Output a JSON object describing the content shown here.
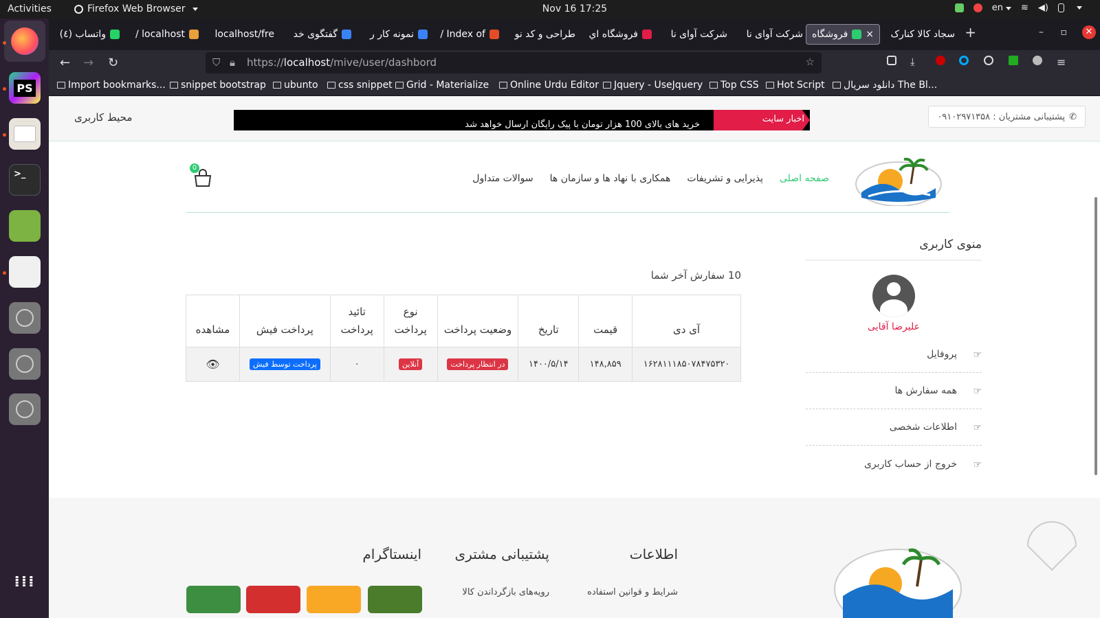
{
  "os": {
    "activities": "Activities",
    "app_name": "Firefox Web Browser",
    "clock": "Nov 16  17:25",
    "lang": "en"
  },
  "tabs": [
    {
      "label": "واتساب (٤)",
      "color": "#25d366"
    },
    {
      "label": "localhost /",
      "color": "#e8a03a"
    },
    {
      "label": "localhost/fre",
      "color": ""
    },
    {
      "label": "گفتگوی خد",
      "color": "#3b82f6"
    },
    {
      "label": "نمونه کار ر",
      "color": "#3b82f6"
    },
    {
      "label": "Index of /",
      "color": "#e34c26"
    },
    {
      "label": "طراحی و کد نو",
      "color": ""
    },
    {
      "label": "فروشگاه اي",
      "color": "#e11d48"
    },
    {
      "label": "شرکت آوای نا",
      "color": ""
    },
    {
      "label": "شرکت آوای نا",
      "color": ""
    },
    {
      "label": "فروشگاه",
      "color": "#2ecc71"
    },
    {
      "label": "سجاد کالا کنارک",
      "color": ""
    }
  ],
  "tab_close": "×",
  "new_tab": "+",
  "url": {
    "prefix": "https://",
    "host": "localhost",
    "path": "/mive/user/dashbord"
  },
  "bookmarks": [
    "Import bookmarks...",
    "snippet bootstrap",
    "ubunto",
    "css snippet",
    "Grid - Materialize",
    "Online Urdu Editor",
    "Jquery - UseJquery",
    "Top CSS",
    "Hot Script",
    "دانلود سریال The Bl..."
  ],
  "site": {
    "support": "پشتیبانی مشتریان : ۰۹۱۰۲۹۷۱۳۵۸",
    "ticker_label": "اخبار سایت",
    "ticker_line1": "خرید های بالای 100 هزار تومان با پیک رایگان ارسال خواهد شد",
    "user_zone": "محیط کاربری",
    "menu": [
      "صفحه اصلی",
      "پذیرایی و تشریفات",
      "همکاری با نهاد ها و سازمان ها",
      "سوالات متداول"
    ],
    "cart_count": "0"
  },
  "sidebar": {
    "title": "منوی کاربری",
    "username": "علیرضا آقایی",
    "items": [
      "پروفایل",
      "همه سفارش ها",
      "اطلاعات شخصی",
      "خروج از حساب کاربری"
    ]
  },
  "orders": {
    "title": "10 سفارش آخر شما",
    "headers": [
      "آی دی",
      "قیمت",
      "تاریخ",
      "وضعیت پرداخت",
      "نوع پرداخت",
      "تائید پرداخت",
      "پرداخت فیش",
      "مشاهده"
    ],
    "row": {
      "id": "۱۶۲۸۱۱۱۸۵۰۷۸۴۷۵۳۲۰",
      "price": "۱۴۸,۸۵۹",
      "date": "۱۴۰۰/۵/۱۴",
      "status": "در انتظار پرداخت",
      "type": "آنلاین",
      "confirm": "۰",
      "receipt": "پرداخت توسط فیش"
    }
  },
  "footer": {
    "info": "اطلاعات",
    "support": "پشتیبانی مشتری",
    "instagram": "اینستاگرام",
    "link1": "شرایط و قوانین استفاده",
    "link2": "رویه‌های بازگرداندن کالا"
  }
}
